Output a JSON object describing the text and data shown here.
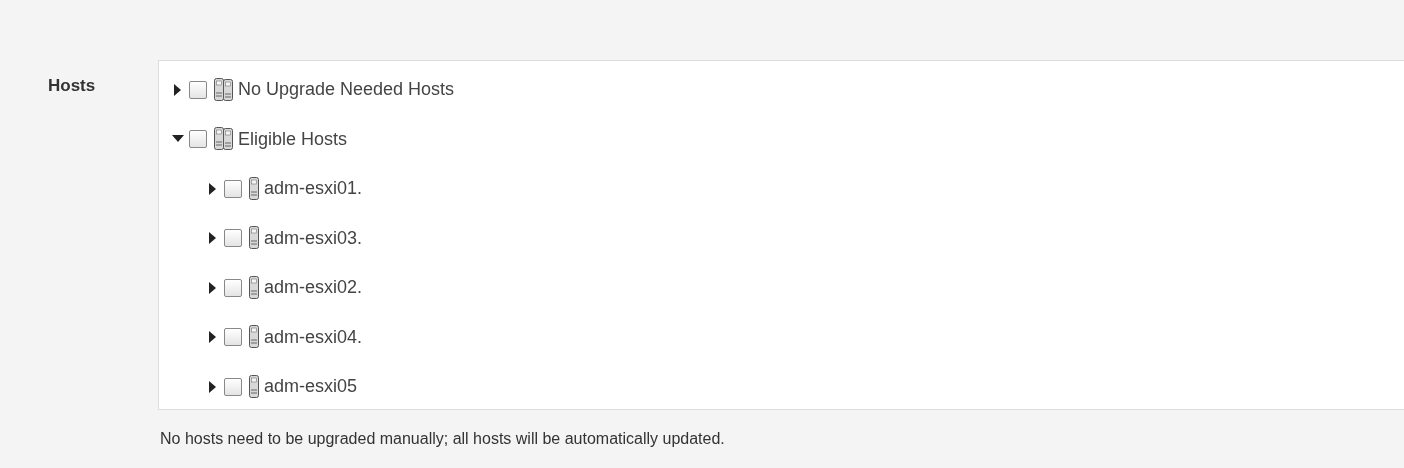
{
  "field_label": "Hosts",
  "tree": [
    {
      "label": "No Upgrade Needed Hosts",
      "kind": "group",
      "expanded": false,
      "checked": false
    },
    {
      "label": "Eligible Hosts",
      "kind": "group",
      "expanded": true,
      "checked": false,
      "children": [
        {
          "label": "adm-esxi01.",
          "kind": "host",
          "expanded": false,
          "checked": false
        },
        {
          "label": "adm-esxi03.",
          "kind": "host",
          "expanded": false,
          "checked": false
        },
        {
          "label": "adm-esxi02.",
          "kind": "host",
          "expanded": false,
          "checked": false
        },
        {
          "label": "adm-esxi04.",
          "kind": "host",
          "expanded": false,
          "checked": false
        },
        {
          "label": "adm-esxi05",
          "kind": "host",
          "expanded": false,
          "checked": false
        }
      ]
    }
  ],
  "note": "No hosts need to be upgraded manually; all hosts will be automatically updated."
}
